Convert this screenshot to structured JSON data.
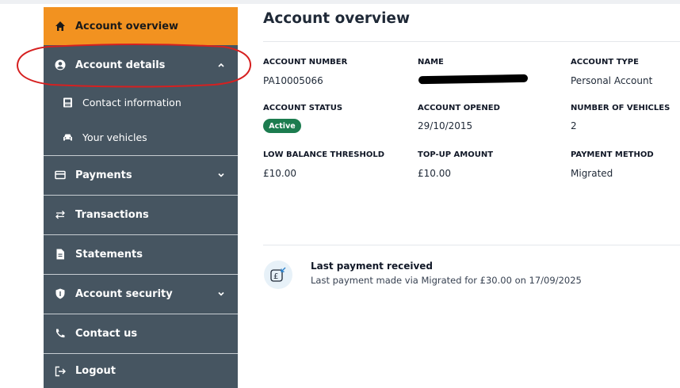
{
  "sidebar": {
    "items": [
      {
        "label": "Account overview",
        "icon": "home-icon"
      },
      {
        "label": "Account details",
        "icon": "user-circle-icon"
      },
      {
        "label": "Payments",
        "icon": "credit-card-icon"
      },
      {
        "label": "Transactions",
        "icon": "arrows-exchange-icon"
      },
      {
        "label": "Statements",
        "icon": "document-icon"
      },
      {
        "label": "Account security",
        "icon": "shield-icon"
      },
      {
        "label": "Contact us",
        "icon": "phone-icon"
      },
      {
        "label": "Logout",
        "icon": "logout-icon"
      }
    ],
    "sub_items": [
      {
        "label": "Contact information",
        "icon": "id-card-icon"
      },
      {
        "label": "Your vehicles",
        "icon": "car-icon"
      }
    ]
  },
  "main": {
    "title": "Account overview",
    "fields": {
      "account_number": {
        "label": "ACCOUNT NUMBER",
        "value": "PA10005066"
      },
      "name": {
        "label": "NAME"
      },
      "account_type": {
        "label": "ACCOUNT TYPE",
        "value": "Personal Account"
      },
      "account_status": {
        "label": "ACCOUNT STATUS",
        "value": "Active"
      },
      "account_opened": {
        "label": "ACCOUNT OPENED",
        "value": "29/10/2015"
      },
      "number_of_vehicles": {
        "label": "NUMBER OF VEHICLES",
        "value": "2"
      },
      "low_balance_threshold": {
        "label": "LOW BALANCE THRESHOLD",
        "value": "£10.00"
      },
      "top_up_amount": {
        "label": "TOP-UP AMOUNT",
        "value": "£10.00"
      },
      "payment_method": {
        "label": "PAYMENT METHOD",
        "value": "Migrated"
      }
    },
    "last_payment": {
      "title": "Last payment received",
      "description": "Last payment made via Migrated for £30.00 on 17/09/2025"
    }
  },
  "colors": {
    "sidebar_bg": "#465561",
    "active_bg": "#f29220",
    "badge_bg": "#1c7c4f",
    "annotation": "#d62020"
  }
}
